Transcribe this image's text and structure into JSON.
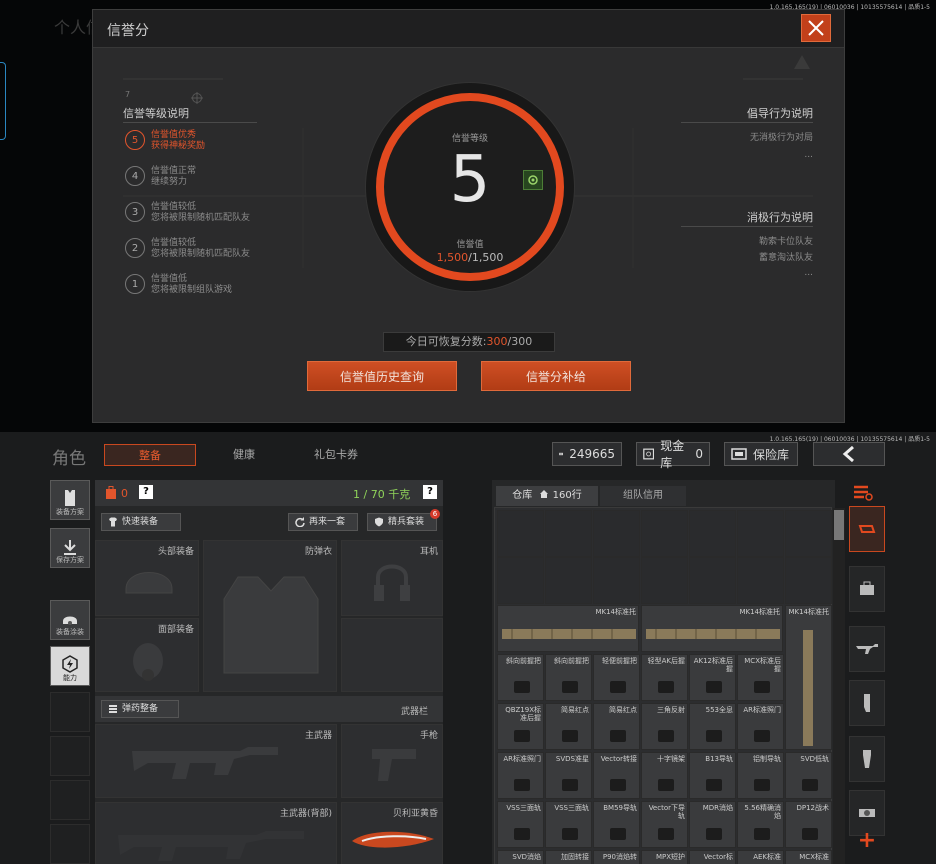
{
  "top": {
    "bg_title": "个人信",
    "version": "1.0.165.165(19) | 06010036 | 10135575614 | 品质1-5",
    "dialog": {
      "title": "信誉分",
      "left_header": "信誉等级说明",
      "left_marker": "7",
      "levels": [
        {
          "num": "5",
          "line1": "信誉值优秀",
          "line2": "获得神秘奖励",
          "active": true
        },
        {
          "num": "4",
          "line1": "信誉值正常",
          "line2": "继续努力",
          "active": false
        },
        {
          "num": "3",
          "line1": "信誉值较低",
          "line2": "您将被限制随机匹配队友",
          "active": false
        },
        {
          "num": "2",
          "line1": "信誉值较低",
          "line2": "您将被限制随机匹配队友",
          "active": false
        },
        {
          "num": "1",
          "line1": "信誉值低",
          "line2": "您将被限制组队游戏",
          "active": false
        }
      ],
      "ring": {
        "level_label": "信誉等级",
        "level": "5",
        "value_label": "信誉值",
        "value_current": "1,500",
        "value_max": "/1,500"
      },
      "right": {
        "guide_header": "倡导行为说明",
        "guide_item": "无消极行为对局",
        "guide_more": "...",
        "neg_header": "消极行为说明",
        "neg_items": [
          "勒索卡位队友",
          "蓄意淘汰队友"
        ],
        "neg_more": "..."
      },
      "recover_prefix": "今日可恢复分数:",
      "recover_current": "300",
      "recover_max": "/300",
      "btn_history": "信誉值历史查询",
      "btn_supply": "信誉分补给"
    }
  },
  "bottom": {
    "version": "1.0.165.165(19) | 06010036 | 10135575614 | 品质1-5",
    "role_title": "角色",
    "tabs": [
      "整备",
      "健康",
      "礼包卡券"
    ],
    "money": "249665",
    "cash_label": "现金库",
    "cash_value": "0",
    "safe_label": "保险库",
    "sidebar": [
      "装备方案",
      "保存方案",
      "装备涂装",
      "能力"
    ],
    "loadout": {
      "bag_count": "0",
      "help": "?",
      "weight": "1 / 70 千克",
      "quick_equip": "快速装备",
      "again": "再来一套",
      "elite": "精兵套装",
      "elite_badge": "6",
      "head": "头部装备",
      "armor": "防弹衣",
      "ear": "耳机",
      "face": "面部装备",
      "ammo_equip": "弹药整备",
      "weapons_bar": "武器栏",
      "primary": "主武器",
      "pistol": "手枪",
      "primary_back": "主武器(背部)",
      "knife": "贝利亚黄昏"
    },
    "warehouse": {
      "tab_warehouse": "仓库",
      "count": "160行",
      "tab_team": "组队信用",
      "long_items": [
        "MK14标准托",
        "MK14标准托",
        "MK14标准托"
      ],
      "rows": [
        [
          "斜向前握把",
          "斜向前握把",
          "轻便前握把",
          "轻型AK后握",
          "AK12标准后握",
          "MCX标准后握"
        ],
        [
          "QBZ19X标准后握",
          "简易红点",
          "简易红点",
          "三角反射",
          "553全息",
          "AR标准照门"
        ],
        [
          "AR标准照门",
          "SVDS准星",
          "Vector转接",
          "十字镜架",
          "B13导轨",
          "铝制导轨",
          "SVD低轨"
        ],
        [
          "VSS三面轨",
          "VSS三面轨",
          "BM59导轨",
          "Vector下导轨",
          "MDR消焰",
          "5.56精确消焰",
          "DP12战术"
        ],
        [
          "SVD消焰",
          "加固转接",
          "P90消焰转",
          "MPX短护",
          "Vector标",
          "AEK标准",
          "MCX标准"
        ]
      ]
    },
    "category_icons": [
      "backpack-icon",
      "rifle-icon",
      "magazine-icon",
      "grip-icon",
      "scope-icon"
    ],
    "accent": "#e2491f"
  }
}
